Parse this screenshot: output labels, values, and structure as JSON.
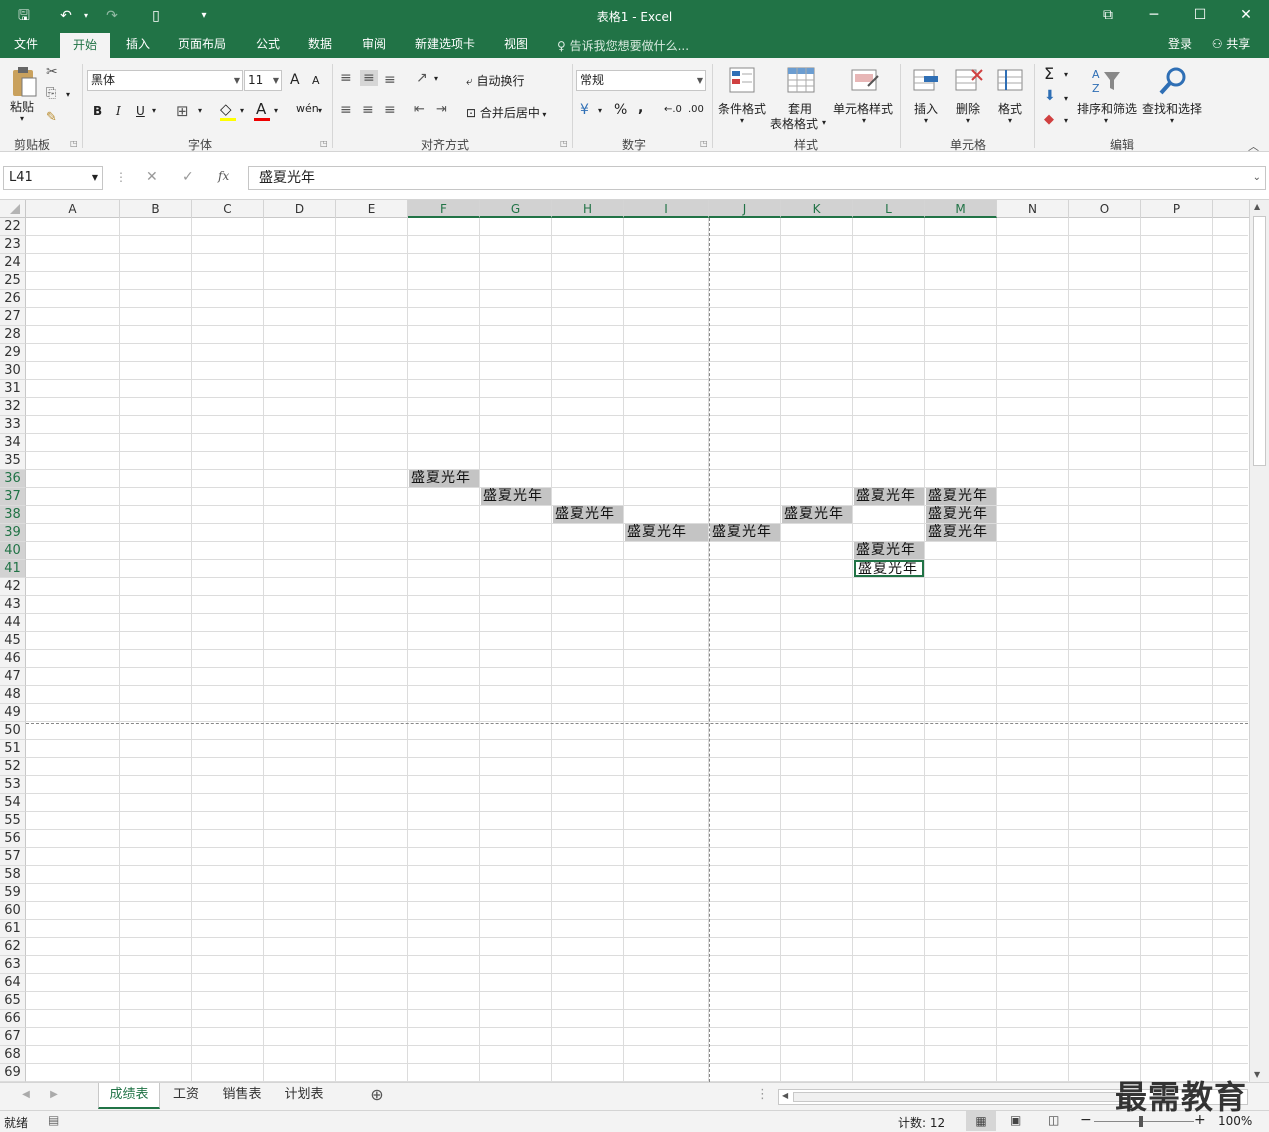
{
  "window": {
    "title": "表格1 - Excel"
  },
  "menu": {
    "tabs": [
      "文件",
      "开始",
      "插入",
      "页面布局",
      "公式",
      "数据",
      "审阅",
      "新建选项卡",
      "视图"
    ],
    "active_tab": "开始",
    "tell_me": "告诉我您想要做什么...",
    "login": "登录",
    "share": "共享"
  },
  "ribbon": {
    "clipboard": {
      "paste": "粘贴",
      "label": "剪贴板"
    },
    "font": {
      "name": "黑体",
      "size": "11",
      "bold": "B",
      "italic": "I",
      "underline": "U",
      "grow": "A",
      "shrink": "A",
      "label": "字体"
    },
    "alignment": {
      "wrap": "自动换行",
      "merge": "合并后居中",
      "label": "对齐方式"
    },
    "number": {
      "format": "常规",
      "percent": "%",
      "comma": ",",
      "label": "数字"
    },
    "styles": {
      "conditional": "条件格式",
      "table_line1": "套用",
      "table_line2": "表格格式",
      "cell_styles": "单元格样式",
      "label": "样式"
    },
    "cells": {
      "insert": "插入",
      "delete": "删除",
      "format": "格式",
      "label": "单元格"
    },
    "editing": {
      "sort": "排序和筛选",
      "find": "查找和选择",
      "label": "编辑",
      "sum": "Σ"
    }
  },
  "formula_bar": {
    "name_box": "L41",
    "fx": "fx",
    "cancel": "✕",
    "confirm": "✓",
    "content": "盛夏光年"
  },
  "columns": [
    "A",
    "B",
    "C",
    "D",
    "E",
    "F",
    "G",
    "H",
    "I",
    "J",
    "K",
    "L",
    "M",
    "N",
    "O",
    "P"
  ],
  "selected_columns": [
    "F",
    "G",
    "H",
    "I",
    "J",
    "K",
    "L",
    "M"
  ],
  "rows": [
    22,
    23,
    24,
    25,
    26,
    27,
    28,
    29,
    30,
    31,
    32,
    33,
    34,
    35,
    36,
    37,
    38,
    39,
    40,
    41,
    42,
    43,
    44,
    45,
    46,
    47,
    48,
    49,
    50,
    51,
    52,
    53,
    54,
    55,
    56,
    57,
    58,
    59,
    60,
    61,
    62,
    63,
    64,
    65,
    66,
    67,
    68,
    69
  ],
  "selected_rows": [
    36,
    37,
    38,
    39,
    40,
    41
  ],
  "cells": [
    {
      "ref": "F36",
      "value": "盛夏光年"
    },
    {
      "ref": "G37",
      "value": "盛夏光年"
    },
    {
      "ref": "H38",
      "value": "盛夏光年"
    },
    {
      "ref": "I39",
      "value": "盛夏光年"
    },
    {
      "ref": "J39",
      "value": "盛夏光年"
    },
    {
      "ref": "K38",
      "value": "盛夏光年"
    },
    {
      "ref": "L37",
      "value": "盛夏光年"
    },
    {
      "ref": "M37",
      "value": "盛夏光年"
    },
    {
      "ref": "M38",
      "value": "盛夏光年"
    },
    {
      "ref": "M39",
      "value": "盛夏光年"
    },
    {
      "ref": "L40",
      "value": "盛夏光年"
    },
    {
      "ref": "L41",
      "value": "盛夏光年"
    }
  ],
  "active_cell": "L41",
  "sheets": [
    "成绩表",
    "工资",
    "销售表",
    "计划表"
  ],
  "active_sheet": "成绩表",
  "status": {
    "mode": "就绪",
    "count": "计数: 12",
    "zoom": "100%"
  },
  "watermark": "最需教育",
  "colors": {
    "accent": "#217346",
    "selected_cell_fill": "#c4c4c4"
  }
}
